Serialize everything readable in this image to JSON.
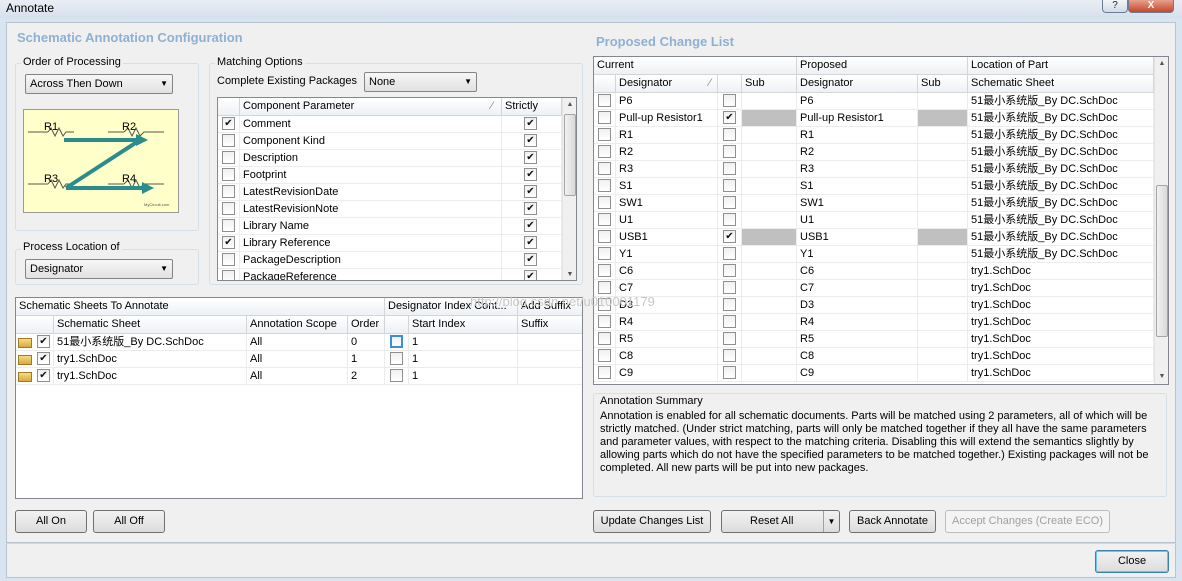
{
  "window": {
    "title": "Annotate",
    "help": "?",
    "close_glyph": "X"
  },
  "config_title": "Schematic Annotation Configuration",
  "order": {
    "label": "Order of Processing",
    "value": "Across Then Down",
    "diagram": {
      "r1": "R1",
      "r2": "R2",
      "r3": "R3",
      "r4": "R4",
      "brand": "MyCircuit.com"
    }
  },
  "location": {
    "label": "Process Location of",
    "value": "Designator"
  },
  "matching": {
    "label": "Matching Options",
    "complete_label": "Complete Existing Packages",
    "complete_value": "None",
    "headers": {
      "param": "Component Parameter",
      "strictly": "Strictly"
    },
    "rows": [
      {
        "name": "Comment",
        "checked": true,
        "strict": true
      },
      {
        "name": "Component Kind",
        "checked": false,
        "strict": true
      },
      {
        "name": "Description",
        "checked": false,
        "strict": true
      },
      {
        "name": "Footprint",
        "checked": false,
        "strict": true
      },
      {
        "name": "LatestRevisionDate",
        "checked": false,
        "strict": true
      },
      {
        "name": "LatestRevisionNote",
        "checked": false,
        "strict": true
      },
      {
        "name": "Library Name",
        "checked": false,
        "strict": true
      },
      {
        "name": "Library Reference",
        "checked": true,
        "strict": true
      },
      {
        "name": "PackageDescription",
        "checked": false,
        "strict": true
      },
      {
        "name": "PackageReference",
        "checked": false,
        "strict": true
      }
    ]
  },
  "sheets": {
    "top_headers": {
      "sheets": "Schematic Sheets To Annotate",
      "index": "Designator Index Cont...",
      "suffix": "Add Suffix"
    },
    "headers": {
      "sheet": "Schematic Sheet",
      "scope": "Annotation Scope",
      "order": "Order",
      "start": "Start Index",
      "suffix": "Suffix"
    },
    "rows": [
      {
        "sheet": "51最小系统版_By DC.SchDoc",
        "scope": "All",
        "order": "0",
        "start": "1",
        "suffix": ""
      },
      {
        "sheet": "try1.SchDoc",
        "scope": "All",
        "order": "1",
        "start": "1",
        "suffix": ""
      },
      {
        "sheet": "try1.SchDoc",
        "scope": "All",
        "order": "2",
        "start": "1",
        "suffix": ""
      }
    ]
  },
  "proposed": {
    "title": "Proposed Change List",
    "group_headers": {
      "current": "Current",
      "proposed": "Proposed",
      "location": "Location of Part"
    },
    "headers": {
      "designator": "Designator",
      "sub": "Sub",
      "pdesignator": "Designator",
      "psub": "Sub",
      "sheet": "Schematic Sheet"
    },
    "rows": [
      {
        "cur": "P6",
        "locked": false,
        "gray": false,
        "prop": "P6",
        "sheet": "51最小系统版_By DC.SchDoc"
      },
      {
        "cur": "Pull-up Resistor1",
        "locked": true,
        "gray": true,
        "prop": "Pull-up Resistor1",
        "sheet": "51最小系统版_By DC.SchDoc"
      },
      {
        "cur": "R1",
        "locked": false,
        "gray": false,
        "prop": "R1",
        "sheet": "51最小系统版_By DC.SchDoc"
      },
      {
        "cur": "R2",
        "locked": false,
        "gray": false,
        "prop": "R2",
        "sheet": "51最小系统版_By DC.SchDoc"
      },
      {
        "cur": "R3",
        "locked": false,
        "gray": false,
        "prop": "R3",
        "sheet": "51最小系统版_By DC.SchDoc"
      },
      {
        "cur": "S1",
        "locked": false,
        "gray": false,
        "prop": "S1",
        "sheet": "51最小系统版_By DC.SchDoc"
      },
      {
        "cur": "SW1",
        "locked": false,
        "gray": false,
        "prop": "SW1",
        "sheet": "51最小系统版_By DC.SchDoc"
      },
      {
        "cur": "U1",
        "locked": false,
        "gray": false,
        "prop": "U1",
        "sheet": "51最小系统版_By DC.SchDoc"
      },
      {
        "cur": "USB1",
        "locked": true,
        "gray": true,
        "prop": "USB1",
        "sheet": "51最小系统版_By DC.SchDoc"
      },
      {
        "cur": "Y1",
        "locked": false,
        "gray": false,
        "prop": "Y1",
        "sheet": "51最小系统版_By DC.SchDoc"
      },
      {
        "cur": "C6",
        "locked": false,
        "gray": false,
        "prop": "C6",
        "sheet": "try1.SchDoc"
      },
      {
        "cur": "C7",
        "locked": false,
        "gray": false,
        "prop": "C7",
        "sheet": "try1.SchDoc"
      },
      {
        "cur": "D3",
        "locked": false,
        "gray": false,
        "prop": "D3",
        "sheet": "try1.SchDoc"
      },
      {
        "cur": "R4",
        "locked": false,
        "gray": false,
        "prop": "R4",
        "sheet": "try1.SchDoc"
      },
      {
        "cur": "R5",
        "locked": false,
        "gray": false,
        "prop": "R5",
        "sheet": "try1.SchDoc"
      },
      {
        "cur": "C8",
        "locked": false,
        "gray": false,
        "prop": "C8",
        "sheet": "try1.SchDoc"
      },
      {
        "cur": "C9",
        "locked": false,
        "gray": false,
        "prop": "C9",
        "sheet": "try1.SchDoc"
      }
    ]
  },
  "summary": {
    "label": "Annotation Summary",
    "text": "Annotation is enabled for all schematic documents. Parts will be matched using 2 parameters, all of which will be strictly matched. (Under strict matching, parts will only be matched together if they all have the same parameters and parameter values, with respect to the matching criteria. Disabling this will extend the semantics slightly by allowing parts which do not have the specified parameters to be matched together.) Existing packages will not be completed. All new parts will be put into new packages."
  },
  "buttons": {
    "all_on": "All On",
    "all_off": "All Off",
    "update": "Update Changes List",
    "reset": "Reset All",
    "back": "Back Annotate",
    "accept": "Accept Changes (Create ECO)",
    "close": "Close"
  },
  "watermark": "http://blog.csdn.net/u010001179"
}
